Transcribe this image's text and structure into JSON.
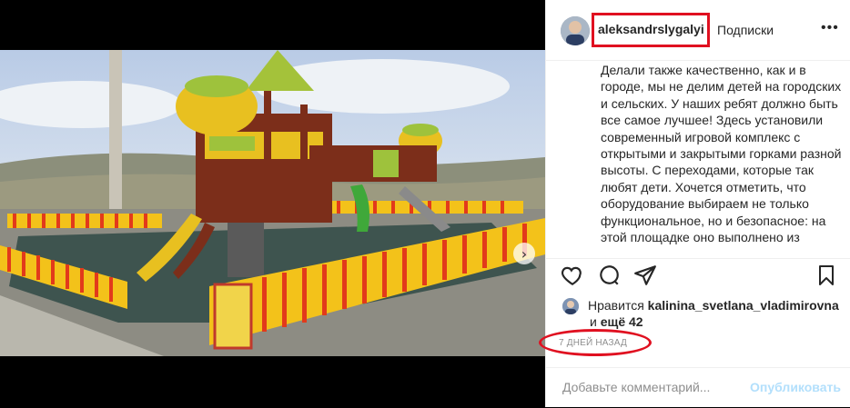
{
  "post": {
    "username": "aleksandrslygalyi",
    "follow_label": "Подписки",
    "more_label": "•••",
    "caption": "Делали также качественно, как и в городе, мы не делим детей на городских и сельских. У наших ребят должно быть все самое лучшее! Здесь установили современный игровой комплекс с открытыми и закрытыми горками разной высоты. С переходами, которые так любят дети. Хочется отметить, что оборудование выбираем не только функциональное, но и безопасное: на этой площадке оно выполнено из",
    "likes_prefix": "Нравится",
    "likes_user": "kalinina_svetlana_vladimirovna",
    "likes_more_prefix": "и",
    "likes_more": "ещё 42",
    "date": "7 ДНЕЙ НАЗАД",
    "comment_placeholder": "Добавьте комментарий...",
    "publish_label": "Опубликовать"
  },
  "icons": {
    "like": "heart-icon",
    "comment": "comment-icon",
    "share": "share-icon",
    "save": "bookmark-icon",
    "next": "chevron-right-icon"
  },
  "colors": {
    "annotation_red": "#e01020",
    "publish_disabled": "#b2dffc",
    "muted_text": "#8e8e8e"
  }
}
